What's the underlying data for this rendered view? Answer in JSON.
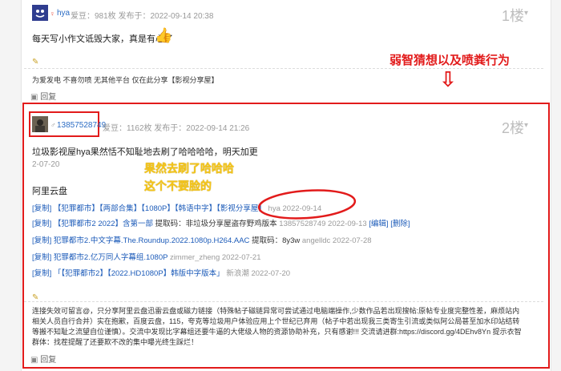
{
  "post1": {
    "username": "hya",
    "meta": "爱豆：981枚 发布于：2022-09-14 20:38",
    "floor": "1楼",
    "content": "每天写小作文诋毁大家，真是有心了",
    "signature": "为爱发电 不喜勿喷 无其他平台 仅在此分享【影视分享屋】",
    "reply": "回复"
  },
  "annotation_top": "弱智猜想以及喷粪行为",
  "post2": {
    "username": "13857528749",
    "meta": "爱豆：1162枚 发布于：2022-09-14 21:26",
    "floor": "2楼",
    "content": "垃圾影视屋hya果然恬不知耻地去刷了哈哈哈哈，明天加更",
    "date1": "2-07-20",
    "yellow_line1": "果然去刷了哈哈哈",
    "yellow_line2": "这个不要脸的",
    "aliyun": "阿里云盘",
    "lines": [
      {
        "copy": "[复制]",
        "text": "【犯罪都市】【两部合集】【1080P】【韩语中字】【影视分享屋】",
        "user": "hya",
        "date": "2022-09-14",
        "extra": ""
      },
      {
        "copy": "[复制]",
        "text": "【犯罪都市2 2022】含第一部",
        "note": "提取码：非垃圾分享屋盗存野鸡版本",
        "user": "13857528749",
        "date": "2022-09-13",
        "extra": "[编辑] [删除]"
      },
      {
        "copy": "[复制]",
        "text": "犯罪都市2.中文字幕.The.Roundup.2022.1080p.H264.AAC",
        "note": "提取码：8y3w",
        "user": "angelldc",
        "date": "2022-07-28",
        "extra": ""
      },
      {
        "copy": "[复制]",
        "text": "犯罪都市2.亿万同人字幕组.1080P",
        "note": "",
        "user": "zimmer_zheng",
        "date": "2022-07-21",
        "extra": ""
      },
      {
        "copy": "[复制]",
        "text": "「【犯罪都市2】【2022.HD1080P】韩版中字版本」",
        "note": "",
        "user": "新浪潮",
        "date": "2022-07-20",
        "extra": ""
      }
    ],
    "signature": "连接失效可留言@，只分享阿里云盘迅雷云盘或磁力链接（特殊帖子磁链异常可尝试通过电脑端操作,少数作品若出现搜帖:原帖专业度完整性差，麻烦站内相关人员自行合并）实在抱歉，百度云盘，115，夸克等垃圾用户体验应用上个世纪已弃用（帖子中若出现我三类寄生引流或类似阿公局甚至加水印站结转等搬不知耻之流望自位谨慎）。交流中发现比字幕组还要牛逼的大佬级人物的资源协助补充，只有感谢!!! 交流请进群:https://discord.gg/4DEhv8Yn 提示衣智群体：找茬提醒了还要欺不改的集中曝光终生踩烂！",
    "reply": "回复"
  },
  "colors": {
    "annotation_red": "#e21b1b",
    "yellow_text": "#f5c518",
    "link_blue": "#1c5bb9"
  }
}
